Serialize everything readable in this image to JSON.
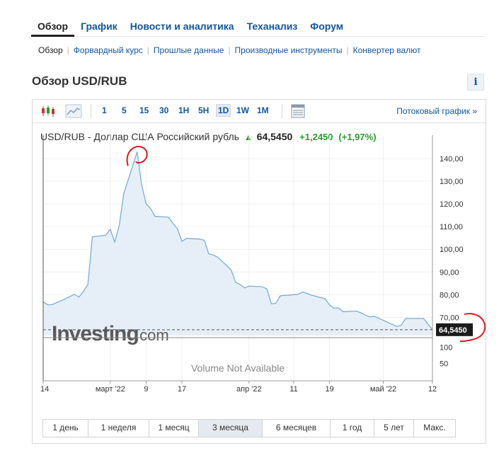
{
  "main_tabs": [
    {
      "label": "Обзор",
      "active": true
    },
    {
      "label": "График"
    },
    {
      "label": "Новости и аналитика"
    },
    {
      "label": "Теханализ"
    },
    {
      "label": "Форум"
    }
  ],
  "sub_tabs": [
    {
      "label": "Обзор",
      "active": true
    },
    {
      "label": "Форвардный курс"
    },
    {
      "label": "Прошлые данные"
    },
    {
      "label": "Производные инструменты"
    },
    {
      "label": "Конвертер валют"
    }
  ],
  "page_title": "Обзор USD/RUB",
  "info_label": "i",
  "toolbar": {
    "intervals": [
      "1",
      "5",
      "15",
      "30",
      "1H",
      "5H",
      "1D",
      "1W",
      "1M"
    ],
    "active_interval": "1D",
    "stream_label": "Потоковый график »"
  },
  "symbol": {
    "name": "USD/RUB - Доллар США Российский рубль",
    "price": "64,5450",
    "change": "+1,2450",
    "change_pct": "(+1,97%)"
  },
  "colors": {
    "accent": "#1256a0",
    "up": "#2a9d2a",
    "line": "#7aaed6",
    "area": "#e6eff8"
  },
  "watermark": {
    "brand": "Investing",
    "suffix": ".com"
  },
  "volume_text": "Volume Not Available",
  "chart_data": {
    "type": "area",
    "x": [
      "2022-02-14",
      "2022-02-15",
      "2022-02-16",
      "2022-02-17",
      "2022-02-18",
      "2022-02-21",
      "2022-02-22",
      "2022-02-23",
      "2022-02-24",
      "2022-02-25",
      "2022-02-28",
      "2022-03-01",
      "2022-03-02",
      "2022-03-03",
      "2022-03-04",
      "2022-03-07",
      "2022-03-08",
      "2022-03-09",
      "2022-03-10",
      "2022-03-11",
      "2022-03-14",
      "2022-03-15",
      "2022-03-16",
      "2022-03-17",
      "2022-03-18",
      "2022-03-21",
      "2022-03-22",
      "2022-03-23",
      "2022-03-24",
      "2022-03-25",
      "2022-03-28",
      "2022-03-29",
      "2022-03-30",
      "2022-03-31",
      "2022-04-01",
      "2022-04-04",
      "2022-04-05",
      "2022-04-06",
      "2022-04-07",
      "2022-04-08",
      "2022-04-11",
      "2022-04-12",
      "2022-04-13",
      "2022-04-14",
      "2022-04-15",
      "2022-04-18",
      "2022-04-19",
      "2022-04-20",
      "2022-04-21",
      "2022-04-22",
      "2022-04-25",
      "2022-04-26",
      "2022-04-27",
      "2022-04-28",
      "2022-04-29",
      "2022-05-04",
      "2022-05-05",
      "2022-05-06",
      "2022-05-10",
      "2022-05-11",
      "2022-05-12"
    ],
    "y": [
      76.8,
      75.5,
      75.6,
      76.5,
      77.3,
      80.2,
      78.9,
      81.5,
      84.5,
      105.5,
      106.2,
      108.8,
      103.2,
      110.5,
      124.5,
      143.0,
      128.5,
      120.0,
      118.0,
      114.5,
      114.2,
      111.5,
      109.0,
      103.5,
      104.8,
      104.5,
      104.0,
      98.0,
      97.5,
      96.5,
      91.0,
      85.5,
      84.5,
      83.0,
      83.8,
      83.5,
      82.5,
      76.0,
      76.2,
      79.5,
      80.0,
      80.2,
      81.2,
      80.5,
      79.8,
      78.2,
      75.5,
      74.0,
      74.2,
      72.5,
      72.8,
      72.0,
      71.0,
      70.2,
      70.5,
      66.0,
      66.5,
      69.5,
      69.5,
      67.0,
      64.545
    ],
    "x_ticks": [
      {
        "label": "14",
        "x": "2022-02-14"
      },
      {
        "label": "март '22",
        "x": "2022-03-01"
      },
      {
        "label": "9",
        "x": "2022-03-09"
      },
      {
        "label": "17",
        "x": "2022-03-17"
      },
      {
        "label": "апр '22",
        "x": "2022-04-01"
      },
      {
        "label": "11",
        "x": "2022-04-11"
      },
      {
        "label": "19",
        "x": "2022-04-19"
      },
      {
        "label": "май '22",
        "x": "2022-05-01"
      },
      {
        "label": "12",
        "x": "2022-05-12"
      }
    ],
    "y_ticks": [
      "140,00",
      "130,00",
      "120,00",
      "110,00",
      "100,00",
      "90,00",
      "80,00",
      "70,00"
    ],
    "y_tick_values": [
      140,
      130,
      120,
      110,
      100,
      90,
      80,
      70
    ],
    "volume_ticks": [
      "100",
      "50"
    ],
    "volume_tick_values": [
      100,
      50
    ],
    "ylim": [
      62,
      145
    ],
    "last_label": "64,5450",
    "grid": true
  },
  "periods": [
    {
      "label": "1 день"
    },
    {
      "label": "1 неделя"
    },
    {
      "label": "1 месяц"
    },
    {
      "label": "3 месяца",
      "active": true
    },
    {
      "label": "6 месяцев"
    },
    {
      "label": "1 год"
    },
    {
      "label": "5 лет"
    },
    {
      "label": "Макс."
    }
  ]
}
